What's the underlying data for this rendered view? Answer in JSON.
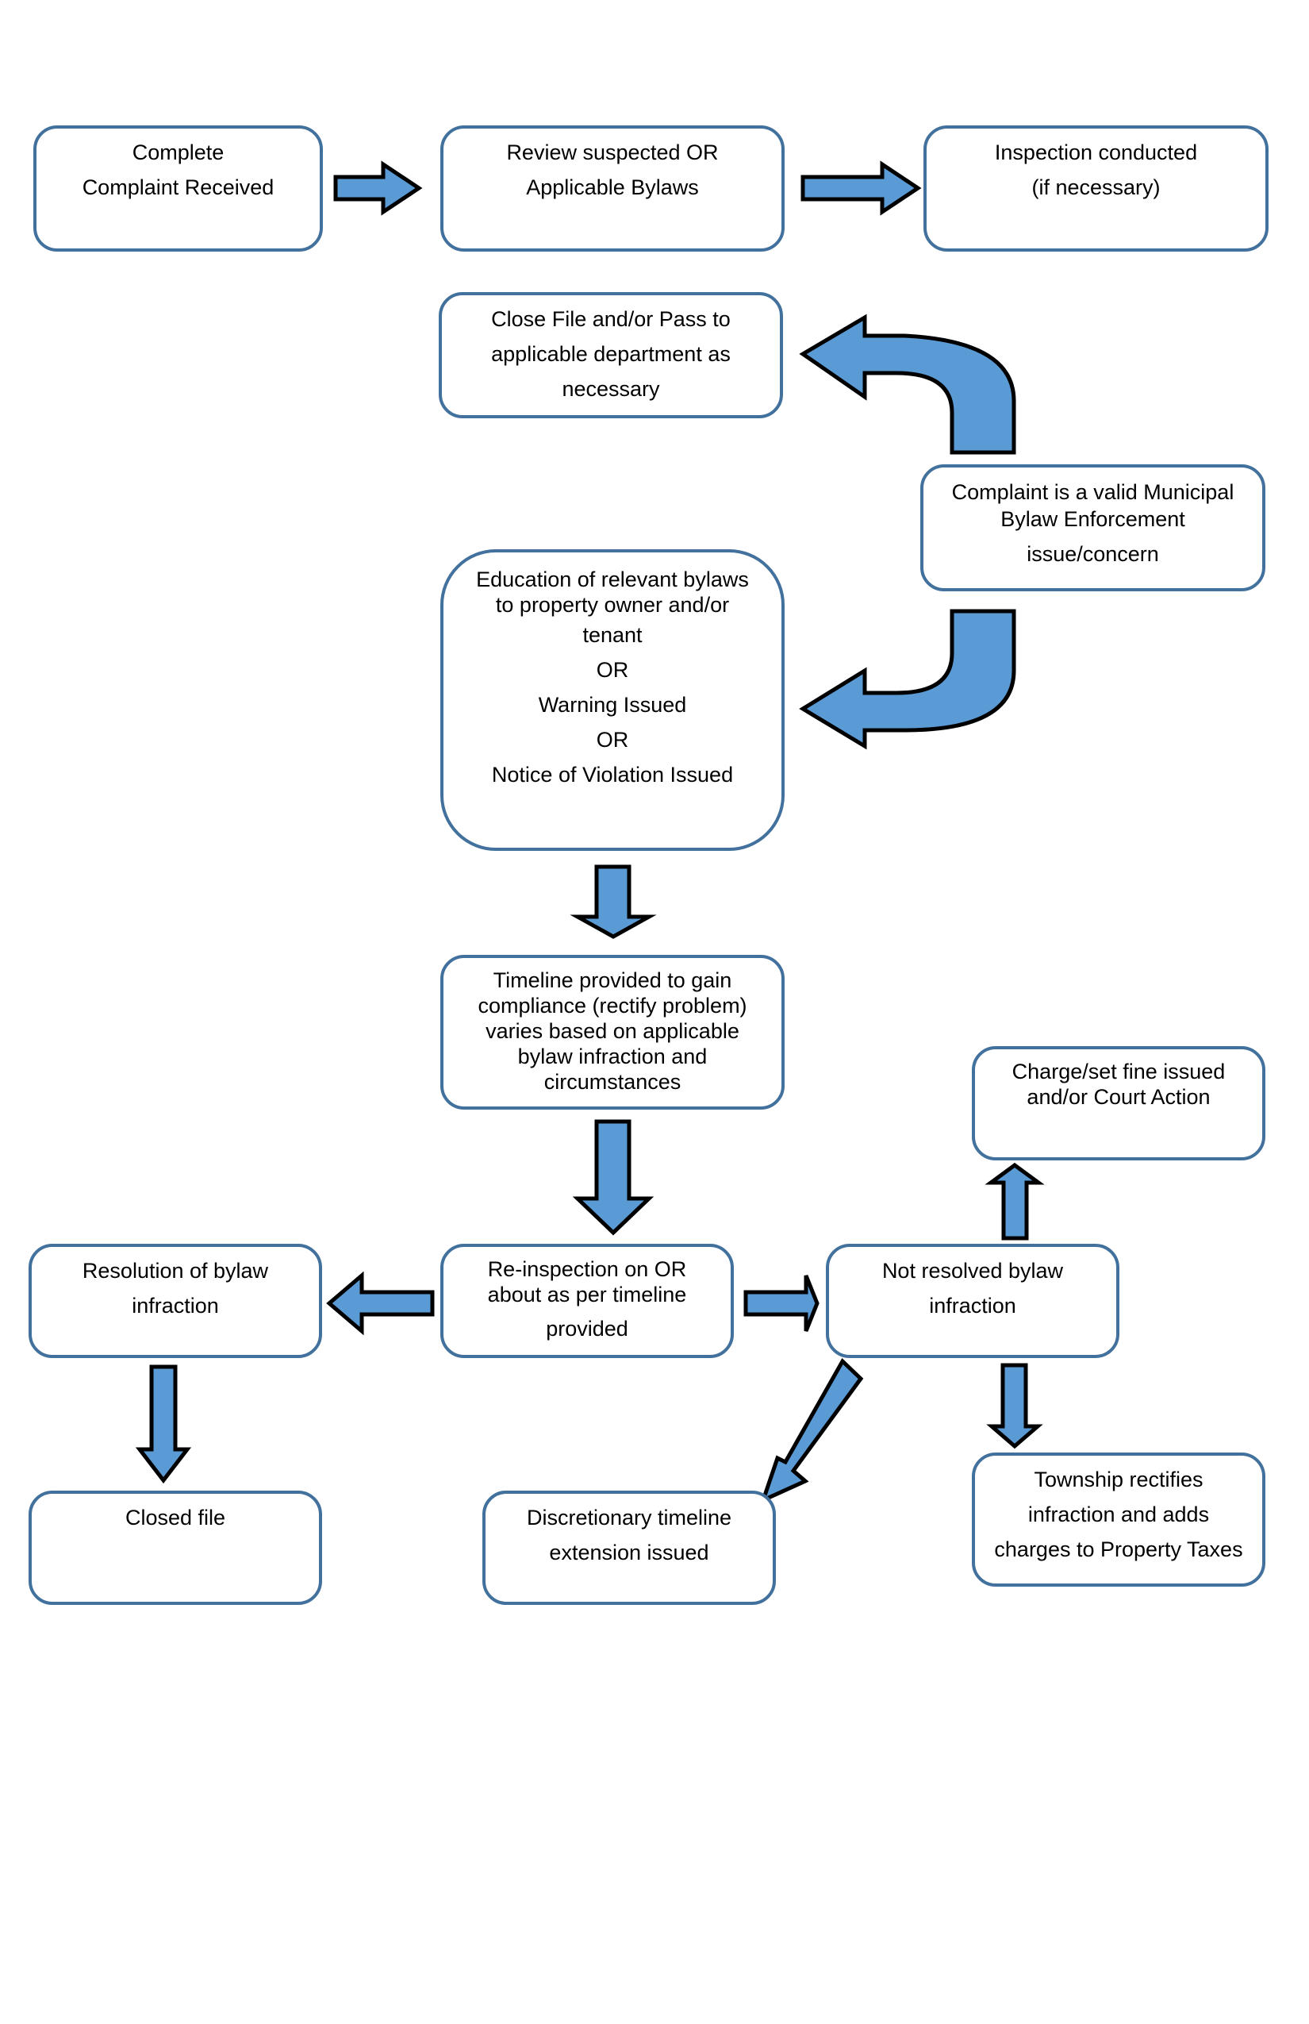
{
  "colors": {
    "box_border": "#41719c",
    "arrow_fill": "#5b9bd5",
    "arrow_stroke": "#000000"
  },
  "nodes": {
    "complaint_received": {
      "lines": [
        "Complete",
        "Complaint Received"
      ]
    },
    "review_bylaws": {
      "lines": [
        "Review suspected OR",
        "Applicable Bylaws"
      ]
    },
    "inspection": {
      "lines": [
        "Inspection conducted",
        "(if necessary)"
      ]
    },
    "close_file_pass": {
      "lines": [
        "Close File and/or Pass to",
        "applicable department as",
        "necessary"
      ]
    },
    "valid_complaint": {
      "lines": [
        "Complaint is a valid Municipal",
        "Bylaw Enforcement",
        "issue/concern"
      ]
    },
    "education": {
      "lines": [
        "Education of relevant bylaws",
        "to property owner and/or",
        "tenant",
        "OR",
        "Warning Issued",
        "OR",
        "Notice of Violation Issued"
      ]
    },
    "timeline": {
      "lines": [
        "Timeline provided to gain",
        "compliance (rectify problem)",
        "varies based on applicable",
        "bylaw infraction and",
        "circumstances"
      ]
    },
    "charge_fine": {
      "lines": [
        "Charge/set fine issued",
        "and/or Court Action"
      ]
    },
    "resolution": {
      "lines": [
        "Resolution of bylaw",
        "infraction"
      ]
    },
    "reinspection": {
      "lines": [
        "Re-inspection on OR",
        "about as per timeline",
        "provided"
      ]
    },
    "not_resolved": {
      "lines": [
        "Not resolved bylaw",
        "infraction"
      ]
    },
    "closed_file": {
      "lines": [
        "Closed file"
      ]
    },
    "discretionary": {
      "lines": [
        "Discretionary timeline",
        "extension issued"
      ]
    },
    "township_rectifies": {
      "lines": [
        "Township rectifies",
        "infraction and adds",
        "charges to Property Taxes"
      ]
    }
  },
  "arrows": [
    {
      "from": "complaint_received",
      "to": "review_bylaws",
      "direction": "right"
    },
    {
      "from": "review_bylaws",
      "to": "inspection",
      "direction": "right"
    },
    {
      "from": "valid_complaint",
      "to": "close_file_pass",
      "direction": "curved-up-left"
    },
    {
      "from": "valid_complaint",
      "to": "education",
      "direction": "curved-down-left"
    },
    {
      "from": "education",
      "to": "timeline",
      "direction": "down"
    },
    {
      "from": "timeline",
      "to": "reinspection",
      "direction": "down"
    },
    {
      "from": "reinspection",
      "to": "resolution",
      "direction": "left"
    },
    {
      "from": "reinspection",
      "to": "not_resolved",
      "direction": "right"
    },
    {
      "from": "not_resolved",
      "to": "charge_fine",
      "direction": "up"
    },
    {
      "from": "resolution",
      "to": "closed_file",
      "direction": "down"
    },
    {
      "from": "not_resolved",
      "to": "discretionary",
      "direction": "down-left"
    },
    {
      "from": "not_resolved",
      "to": "township_rectifies",
      "direction": "down"
    }
  ]
}
